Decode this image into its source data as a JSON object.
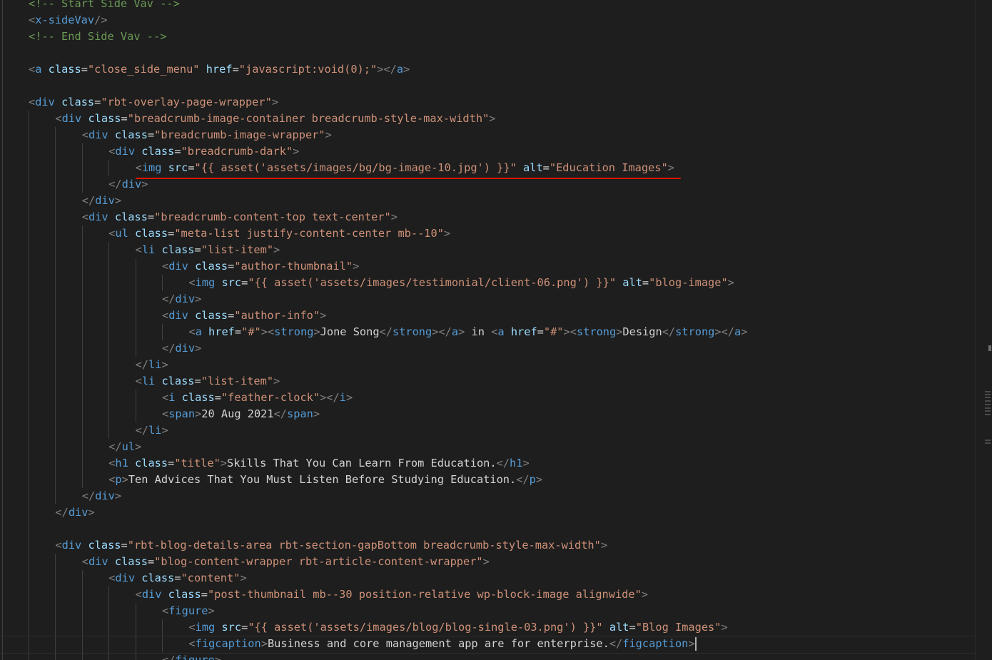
{
  "editor": {
    "lines": [
      {
        "indent": 0,
        "tokens": [
          [
            "com",
            "<!-- Start Side Vav -->"
          ]
        ]
      },
      {
        "indent": 0,
        "tokens": [
          [
            "brk",
            "<"
          ],
          [
            "tag",
            "x-sideVav"
          ],
          [
            "brk",
            "/>"
          ]
        ]
      },
      {
        "indent": 0,
        "tokens": [
          [
            "com",
            "<!-- End Side Vav -->"
          ]
        ]
      },
      {
        "indent": 0,
        "tokens": []
      },
      {
        "indent": 0,
        "tokens": [
          [
            "brk",
            "<"
          ],
          [
            "tag",
            "a"
          ],
          [
            "txt",
            " "
          ],
          [
            "attr",
            "class"
          ],
          [
            "eq",
            "="
          ],
          [
            "str",
            "\"close_side_menu\""
          ],
          [
            "txt",
            " "
          ],
          [
            "attr",
            "href"
          ],
          [
            "eq",
            "="
          ],
          [
            "str",
            "\"javascript:void(0);\""
          ],
          [
            "brk",
            "></"
          ],
          [
            "tag",
            "a"
          ],
          [
            "brk",
            ">"
          ]
        ]
      },
      {
        "indent": 0,
        "tokens": []
      },
      {
        "indent": 0,
        "tokens": [
          [
            "brk",
            "<"
          ],
          [
            "tag",
            "div"
          ],
          [
            "txt",
            " "
          ],
          [
            "attr",
            "class"
          ],
          [
            "eq",
            "="
          ],
          [
            "str",
            "\"rbt-overlay-page-wrapper\""
          ],
          [
            "brk",
            ">"
          ]
        ]
      },
      {
        "indent": 1,
        "tokens": [
          [
            "brk",
            "<"
          ],
          [
            "tag",
            "div"
          ],
          [
            "txt",
            " "
          ],
          [
            "attr",
            "class"
          ],
          [
            "eq",
            "="
          ],
          [
            "str",
            "\"breadcrumb-image-container breadcrumb-style-max-width\""
          ],
          [
            "brk",
            ">"
          ]
        ]
      },
      {
        "indent": 2,
        "tokens": [
          [
            "brk",
            "<"
          ],
          [
            "tag",
            "div"
          ],
          [
            "txt",
            " "
          ],
          [
            "attr",
            "class"
          ],
          [
            "eq",
            "="
          ],
          [
            "str",
            "\"breadcrumb-image-wrapper\""
          ],
          [
            "brk",
            ">"
          ]
        ]
      },
      {
        "indent": 3,
        "tokens": [
          [
            "brk",
            "<"
          ],
          [
            "tag",
            "div"
          ],
          [
            "txt",
            " "
          ],
          [
            "attr",
            "class"
          ],
          [
            "eq",
            "="
          ],
          [
            "str",
            "\"breadcrumb-dark\""
          ],
          [
            "brk",
            ">"
          ]
        ]
      },
      {
        "indent": 4,
        "tokens": [
          [
            "brk",
            "<"
          ],
          [
            "tag",
            "img"
          ],
          [
            "txt",
            " "
          ],
          [
            "attr",
            "src"
          ],
          [
            "eq",
            "="
          ],
          [
            "str",
            "\"{{ asset('assets/images/bg/bg-image-10.jpg') }}\""
          ],
          [
            "txt",
            " "
          ],
          [
            "attr",
            "alt"
          ],
          [
            "eq",
            "="
          ],
          [
            "str",
            "\"Education Images\""
          ],
          [
            "brk",
            ">"
          ]
        ]
      },
      {
        "indent": 3,
        "tokens": [
          [
            "brk",
            "</"
          ],
          [
            "tag",
            "div"
          ],
          [
            "brk",
            ">"
          ]
        ]
      },
      {
        "indent": 2,
        "tokens": [
          [
            "brk",
            "</"
          ],
          [
            "tag",
            "div"
          ],
          [
            "brk",
            ">"
          ]
        ]
      },
      {
        "indent": 2,
        "tokens": [
          [
            "brk",
            "<"
          ],
          [
            "tag",
            "div"
          ],
          [
            "txt",
            " "
          ],
          [
            "attr",
            "class"
          ],
          [
            "eq",
            "="
          ],
          [
            "str",
            "\"breadcrumb-content-top text-center\""
          ],
          [
            "brk",
            ">"
          ]
        ]
      },
      {
        "indent": 3,
        "tokens": [
          [
            "brk",
            "<"
          ],
          [
            "tag",
            "ul"
          ],
          [
            "txt",
            " "
          ],
          [
            "attr",
            "class"
          ],
          [
            "eq",
            "="
          ],
          [
            "str",
            "\"meta-list justify-content-center mb--10\""
          ],
          [
            "brk",
            ">"
          ]
        ]
      },
      {
        "indent": 4,
        "tokens": [
          [
            "brk",
            "<"
          ],
          [
            "tag",
            "li"
          ],
          [
            "txt",
            " "
          ],
          [
            "attr",
            "class"
          ],
          [
            "eq",
            "="
          ],
          [
            "str",
            "\"list-item\""
          ],
          [
            "brk",
            ">"
          ]
        ]
      },
      {
        "indent": 5,
        "tokens": [
          [
            "brk",
            "<"
          ],
          [
            "tag",
            "div"
          ],
          [
            "txt",
            " "
          ],
          [
            "attr",
            "class"
          ],
          [
            "eq",
            "="
          ],
          [
            "str",
            "\"author-thumbnail\""
          ],
          [
            "brk",
            ">"
          ]
        ]
      },
      {
        "indent": 6,
        "tokens": [
          [
            "brk",
            "<"
          ],
          [
            "tag",
            "img"
          ],
          [
            "txt",
            " "
          ],
          [
            "attr",
            "src"
          ],
          [
            "eq",
            "="
          ],
          [
            "str",
            "\"{{ asset('assets/images/testimonial/client-06.png') }}\""
          ],
          [
            "txt",
            " "
          ],
          [
            "attr",
            "alt"
          ],
          [
            "eq",
            "="
          ],
          [
            "str",
            "\"blog-image\""
          ],
          [
            "brk",
            ">"
          ]
        ]
      },
      {
        "indent": 5,
        "tokens": [
          [
            "brk",
            "</"
          ],
          [
            "tag",
            "div"
          ],
          [
            "brk",
            ">"
          ]
        ]
      },
      {
        "indent": 5,
        "tokens": [
          [
            "brk",
            "<"
          ],
          [
            "tag",
            "div"
          ],
          [
            "txt",
            " "
          ],
          [
            "attr",
            "class"
          ],
          [
            "eq",
            "="
          ],
          [
            "str",
            "\"author-info\""
          ],
          [
            "brk",
            ">"
          ]
        ]
      },
      {
        "indent": 6,
        "tokens": [
          [
            "brk",
            "<"
          ],
          [
            "tag",
            "a"
          ],
          [
            "txt",
            " "
          ],
          [
            "attr",
            "href"
          ],
          [
            "eq",
            "="
          ],
          [
            "str",
            "\"#\""
          ],
          [
            "brk",
            "><"
          ],
          [
            "tag",
            "strong"
          ],
          [
            "brk",
            ">"
          ],
          [
            "txt",
            "Jone Song"
          ],
          [
            "brk",
            "</"
          ],
          [
            "tag",
            "strong"
          ],
          [
            "brk",
            "></"
          ],
          [
            "tag",
            "a"
          ],
          [
            "brk",
            ">"
          ],
          [
            "txt",
            " in "
          ],
          [
            "brk",
            "<"
          ],
          [
            "tag",
            "a"
          ],
          [
            "txt",
            " "
          ],
          [
            "attr",
            "href"
          ],
          [
            "eq",
            "="
          ],
          [
            "str",
            "\"#\""
          ],
          [
            "brk",
            "><"
          ],
          [
            "tag",
            "strong"
          ],
          [
            "brk",
            ">"
          ],
          [
            "txt",
            "Design"
          ],
          [
            "brk",
            "</"
          ],
          [
            "tag",
            "strong"
          ],
          [
            "brk",
            "></"
          ],
          [
            "tag",
            "a"
          ],
          [
            "brk",
            ">"
          ]
        ]
      },
      {
        "indent": 5,
        "tokens": [
          [
            "brk",
            "</"
          ],
          [
            "tag",
            "div"
          ],
          [
            "brk",
            ">"
          ]
        ]
      },
      {
        "indent": 4,
        "tokens": [
          [
            "brk",
            "</"
          ],
          [
            "tag",
            "li"
          ],
          [
            "brk",
            ">"
          ]
        ]
      },
      {
        "indent": 4,
        "tokens": [
          [
            "brk",
            "<"
          ],
          [
            "tag",
            "li"
          ],
          [
            "txt",
            " "
          ],
          [
            "attr",
            "class"
          ],
          [
            "eq",
            "="
          ],
          [
            "str",
            "\"list-item\""
          ],
          [
            "brk",
            ">"
          ]
        ]
      },
      {
        "indent": 5,
        "tokens": [
          [
            "brk",
            "<"
          ],
          [
            "tag",
            "i"
          ],
          [
            "txt",
            " "
          ],
          [
            "attr",
            "class"
          ],
          [
            "eq",
            "="
          ],
          [
            "str",
            "\"feather-clock\""
          ],
          [
            "brk",
            "></"
          ],
          [
            "tag",
            "i"
          ],
          [
            "brk",
            ">"
          ]
        ]
      },
      {
        "indent": 5,
        "tokens": [
          [
            "brk",
            "<"
          ],
          [
            "tag",
            "span"
          ],
          [
            "brk",
            ">"
          ],
          [
            "txt",
            "20 Aug 2021"
          ],
          [
            "brk",
            "</"
          ],
          [
            "tag",
            "span"
          ],
          [
            "brk",
            ">"
          ]
        ]
      },
      {
        "indent": 4,
        "tokens": [
          [
            "brk",
            "</"
          ],
          [
            "tag",
            "li"
          ],
          [
            "brk",
            ">"
          ]
        ]
      },
      {
        "indent": 3,
        "tokens": [
          [
            "brk",
            "</"
          ],
          [
            "tag",
            "ul"
          ],
          [
            "brk",
            ">"
          ]
        ]
      },
      {
        "indent": 3,
        "tokens": [
          [
            "brk",
            "<"
          ],
          [
            "tag",
            "h1"
          ],
          [
            "txt",
            " "
          ],
          [
            "attr",
            "class"
          ],
          [
            "eq",
            "="
          ],
          [
            "str",
            "\"title\""
          ],
          [
            "brk",
            ">"
          ],
          [
            "txt",
            "Skills That You Can Learn From Education."
          ],
          [
            "brk",
            "</"
          ],
          [
            "tag",
            "h1"
          ],
          [
            "brk",
            ">"
          ]
        ]
      },
      {
        "indent": 3,
        "tokens": [
          [
            "brk",
            "<"
          ],
          [
            "tag",
            "p"
          ],
          [
            "brk",
            ">"
          ],
          [
            "txt",
            "Ten Advices That You Must Listen Before Studying Education."
          ],
          [
            "brk",
            "</"
          ],
          [
            "tag",
            "p"
          ],
          [
            "brk",
            ">"
          ]
        ]
      },
      {
        "indent": 2,
        "tokens": [
          [
            "brk",
            "</"
          ],
          [
            "tag",
            "div"
          ],
          [
            "brk",
            ">"
          ]
        ]
      },
      {
        "indent": 1,
        "tokens": [
          [
            "brk",
            "</"
          ],
          [
            "tag",
            "div"
          ],
          [
            "brk",
            ">"
          ]
        ]
      },
      {
        "indent": 0,
        "tokens": []
      },
      {
        "indent": 1,
        "tokens": [
          [
            "brk",
            "<"
          ],
          [
            "tag",
            "div"
          ],
          [
            "txt",
            " "
          ],
          [
            "attr",
            "class"
          ],
          [
            "eq",
            "="
          ],
          [
            "str",
            "\"rbt-blog-details-area rbt-section-gapBottom breadcrumb-style-max-width\""
          ],
          [
            "brk",
            ">"
          ]
        ]
      },
      {
        "indent": 2,
        "tokens": [
          [
            "brk",
            "<"
          ],
          [
            "tag",
            "div"
          ],
          [
            "txt",
            " "
          ],
          [
            "attr",
            "class"
          ],
          [
            "eq",
            "="
          ],
          [
            "str",
            "\"blog-content-wrapper rbt-article-content-wrapper\""
          ],
          [
            "brk",
            ">"
          ]
        ]
      },
      {
        "indent": 3,
        "tokens": [
          [
            "brk",
            "<"
          ],
          [
            "tag",
            "div"
          ],
          [
            "txt",
            " "
          ],
          [
            "attr",
            "class"
          ],
          [
            "eq",
            "="
          ],
          [
            "str",
            "\"content\""
          ],
          [
            "brk",
            ">"
          ]
        ]
      },
      {
        "indent": 4,
        "tokens": [
          [
            "brk",
            "<"
          ],
          [
            "tag",
            "div"
          ],
          [
            "txt",
            " "
          ],
          [
            "attr",
            "class"
          ],
          [
            "eq",
            "="
          ],
          [
            "str",
            "\"post-thumbnail mb--30 position-relative wp-block-image alignwide\""
          ],
          [
            "brk",
            ">"
          ]
        ]
      },
      {
        "indent": 5,
        "tokens": [
          [
            "brk",
            "<"
          ],
          [
            "tag",
            "figure"
          ],
          [
            "brk",
            ">"
          ]
        ]
      },
      {
        "indent": 6,
        "tokens": [
          [
            "brk",
            "<"
          ],
          [
            "tag",
            "img"
          ],
          [
            "txt",
            " "
          ],
          [
            "attr",
            "src"
          ],
          [
            "eq",
            "="
          ],
          [
            "str",
            "\"{{ asset('assets/images/blog/blog-single-03.png') }}\""
          ],
          [
            "txt",
            " "
          ],
          [
            "attr",
            "alt"
          ],
          [
            "eq",
            "="
          ],
          [
            "str",
            "\"Blog Images\""
          ],
          [
            "brk",
            ">"
          ]
        ]
      },
      {
        "indent": 6,
        "tokens": [
          [
            "brk",
            "<"
          ],
          [
            "tag",
            "figcaption"
          ],
          [
            "brk",
            ">"
          ],
          [
            "txt",
            "Business and core management app are for enterprise."
          ],
          [
            "brk",
            "</"
          ],
          [
            "tag",
            "figcaption"
          ],
          [
            "brk",
            ">"
          ]
        ]
      },
      {
        "indent": 5,
        "tokens": [
          [
            "brk",
            "</"
          ],
          [
            "tag",
            "figure"
          ],
          [
            "brk",
            ">"
          ]
        ]
      }
    ]
  },
  "colors": {
    "background": "#1e1e1e",
    "comment": "#6a9955",
    "tag": "#569cd6",
    "attribute": "#9cdcfe",
    "string": "#ce9178",
    "text": "#d4d4d4",
    "bracket": "#808080",
    "annotation_underline": "#e51400"
  }
}
